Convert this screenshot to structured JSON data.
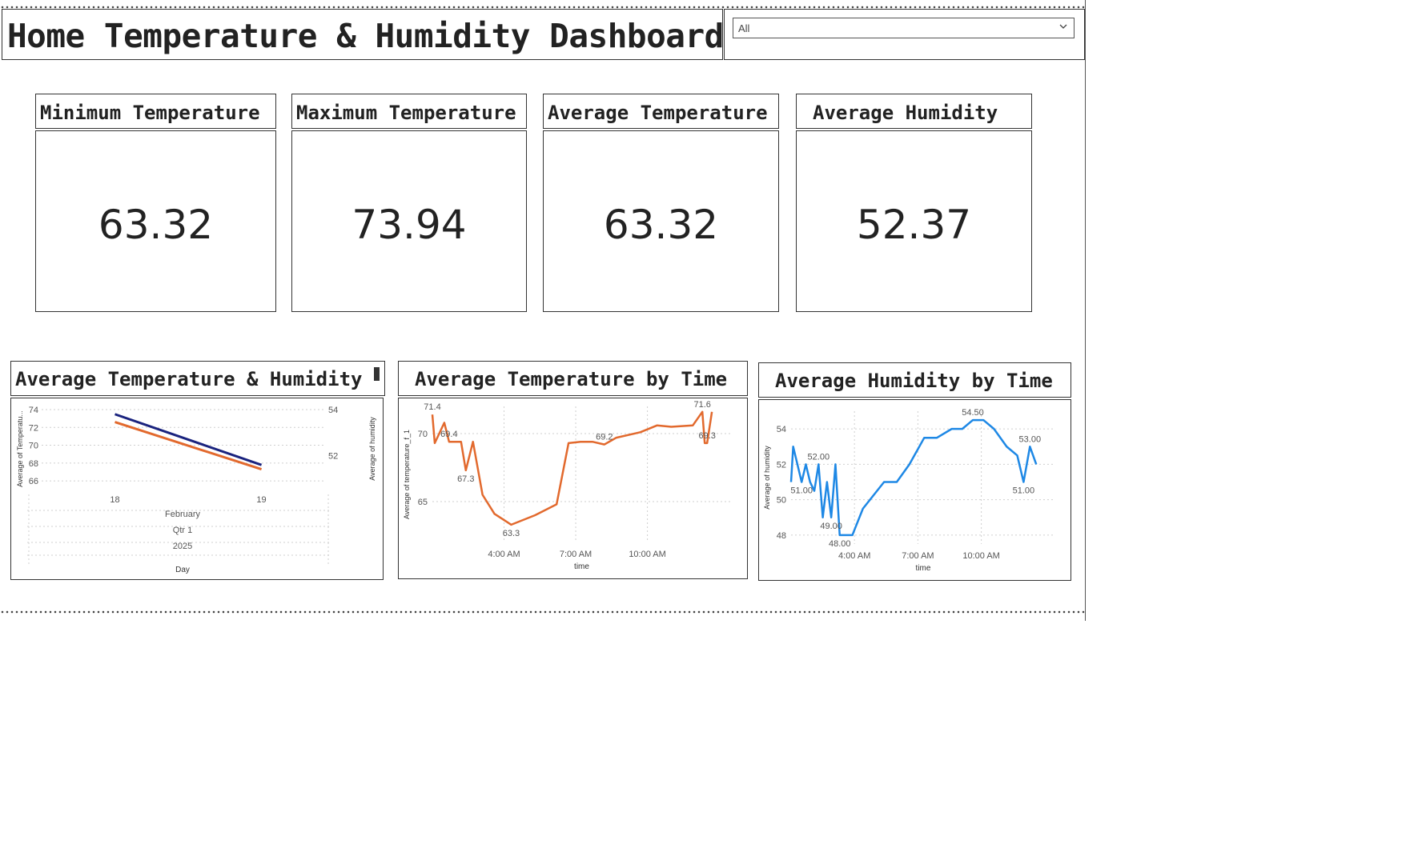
{
  "header": {
    "title": "Home Temperature & Humidity Dashboard"
  },
  "slicer": {
    "selected": "All"
  },
  "cards": [
    {
      "label": "Minimum Temperature",
      "value": "63.32"
    },
    {
      "label": "Maximum Temperature",
      "value": "73.94"
    },
    {
      "label": "Average Temperature",
      "value": "63.32"
    },
    {
      "label": "Average Humidity",
      "value": "52.37"
    }
  ],
  "charts": {
    "temp_humidity": {
      "title": "Average Temperature & Humidity"
    },
    "temp_by_time": {
      "title": "Average Temperature by Time"
    },
    "humidity_by_time": {
      "title": "Average Humidity by Time"
    }
  },
  "colors": {
    "temperature": "#E2692D",
    "humidity_dual": "#1A237E",
    "humidity": "#1E88E5",
    "grid": "#cfcfcf"
  },
  "chart_data": [
    {
      "type": "line",
      "title": "Average Temperature & Humidity",
      "x": [
        "18",
        "19"
      ],
      "xlabel": "Day",
      "x_hierarchy": [
        "February",
        "Qtr 1",
        "2025"
      ],
      "ylabel": "Average of Temperatu...",
      "ylabel_right": "Average of humidity",
      "ylim": [
        65.2,
        74
      ],
      "ylim_right": [
        50.6,
        54
      ],
      "yticks": [
        66,
        68,
        70,
        72,
        74
      ],
      "yticks_right": [
        52,
        54
      ],
      "series": [
        {
          "axis": "left",
          "color": "#E2692D",
          "values": [
            72.6,
            67.3
          ]
        },
        {
          "axis": "right",
          "color": "#1A237E",
          "values": [
            53.8,
            51.6
          ]
        }
      ],
      "grid": true
    },
    {
      "type": "line",
      "title": "Average Temperature by Time",
      "xlabel": "time",
      "ylabel": "Average of temperature_f_1",
      "xticks": [
        [
          "4:00 AM",
          4
        ],
        [
          "7:00 AM",
          7
        ],
        [
          "10:00 AM",
          10
        ]
      ],
      "xlim": [
        1.0,
        13.5
      ],
      "ylim": [
        62,
        72
      ],
      "yticks": [
        65,
        70
      ],
      "x": [
        1.0,
        1.1,
        1.5,
        1.7,
        2.2,
        2.4,
        2.7,
        3.1,
        3.6,
        4.3,
        5.3,
        6.2,
        6.7,
        7.2,
        7.7,
        8.2,
        8.7,
        9.7,
        10.4,
        11.0,
        11.9,
        12.3,
        12.4,
        12.5,
        12.7
      ],
      "values": [
        71.4,
        69.3,
        70.8,
        69.4,
        69.4,
        67.3,
        69.4,
        65.5,
        64.1,
        63.3,
        64.0,
        64.8,
        69.3,
        69.4,
        69.4,
        69.2,
        69.7,
        70.1,
        70.6,
        70.5,
        70.6,
        71.6,
        69.3,
        69.3,
        71.6
      ],
      "data_labels": [
        [
          "71.4",
          0
        ],
        [
          "69.4",
          3
        ],
        [
          "67.3",
          5
        ],
        [
          "63.3",
          9
        ],
        [
          "69.2",
          15
        ],
        [
          "71.6",
          21
        ],
        [
          "69.3",
          23
        ]
      ],
      "color": "#E2692D",
      "grid": true
    },
    {
      "type": "line",
      "title": "Average Humidity by Time",
      "xlabel": "time",
      "ylabel": "Average of humidity",
      "xticks": [
        [
          "4:00 AM",
          4
        ],
        [
          "7:00 AM",
          7
        ],
        [
          "10:00 AM",
          10
        ]
      ],
      "xlim": [
        1.0,
        13.5
      ],
      "ylim": [
        47.5,
        55
      ],
      "yticks": [
        48,
        50,
        52,
        54
      ],
      "x": [
        1.0,
        1.1,
        1.5,
        1.7,
        1.9,
        2.1,
        2.3,
        2.5,
        2.7,
        2.9,
        3.1,
        3.3,
        3.9,
        4.4,
        5.4,
        6.0,
        6.6,
        7.3,
        7.9,
        8.6,
        9.1,
        9.6,
        10.1,
        10.6,
        11.2,
        11.7,
        12.0,
        12.3,
        12.6
      ],
      "values": [
        51.0,
        53.0,
        51.0,
        52.0,
        51.0,
        50.5,
        52.0,
        49.0,
        51.0,
        49.0,
        52.0,
        48.0,
        48.0,
        49.5,
        51.0,
        51.0,
        52.0,
        53.5,
        53.5,
        54.0,
        54.0,
        54.5,
        54.5,
        54.0,
        53.0,
        52.5,
        51.0,
        53.0,
        52.0
      ],
      "data_labels": [
        [
          "51.00",
          2
        ],
        [
          "52.00",
          6
        ],
        [
          "49.00",
          9
        ],
        [
          "48.00",
          11
        ],
        [
          "54.50",
          21
        ],
        [
          "51.00",
          26
        ],
        [
          "53.00",
          27
        ]
      ],
      "color": "#1E88E5",
      "grid": true
    }
  ]
}
